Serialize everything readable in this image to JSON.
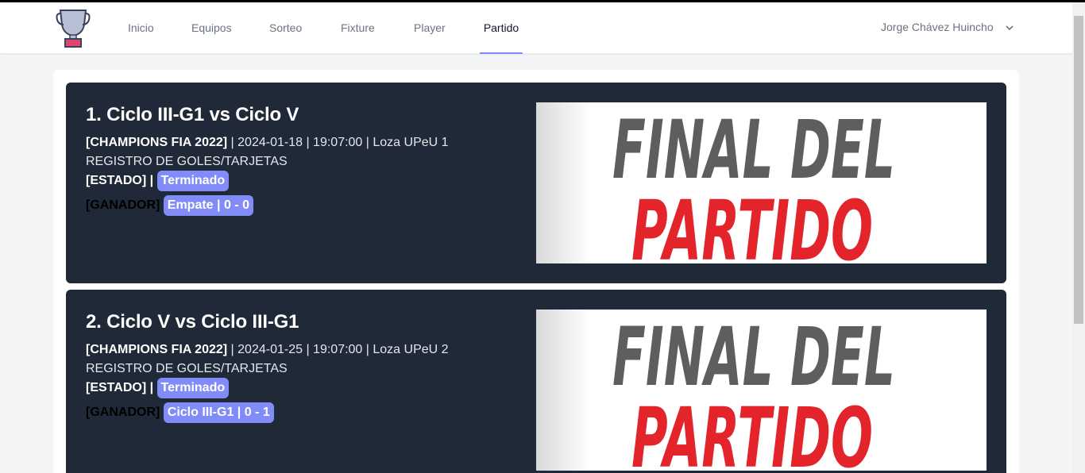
{
  "nav": {
    "items": [
      "Inicio",
      "Equipos",
      "Sorteo",
      "Fixture",
      "Player",
      "Partido"
    ],
    "active": "Partido",
    "user_name": "Jorge Chávez Huincho"
  },
  "matches": [
    {
      "title": "1. Ciclo III-G1 vs Ciclo V",
      "tournament": "[CHAMPIONS FIA 2022]",
      "details": " | 2024-01-18 | 19:07:00 | Loza UPeU 1",
      "registro": "REGISTRO DE GOLES/TARJETAS",
      "estado_label": "[ESTADO] |",
      "estado_value": "Terminado",
      "ganador_label": "[GANADOR]",
      "ganador_value": "Empate | 0 - 0",
      "image_line1": "FINAL DEL",
      "image_line2": "PARTIDO"
    },
    {
      "title": "2. Ciclo V vs Ciclo III-G1",
      "tournament": "[CHAMPIONS FIA 2022]",
      "details": " | 2024-01-25 | 19:07:00 | Loza UPeU 2",
      "registro": "REGISTRO DE GOLES/TARJETAS",
      "estado_label": "[ESTADO] |",
      "estado_value": "Terminado",
      "ganador_label": "[GANADOR]",
      "ganador_value": "Ciclo III-G1 | 0 - 1",
      "image_line1": "FINAL DEL",
      "image_line2": "PARTIDO"
    }
  ],
  "colors": {
    "card_bg": "#1f2937",
    "badge": "#818cf8",
    "accent_red": "#e3242b",
    "gray_text": "#5e5e5e"
  }
}
